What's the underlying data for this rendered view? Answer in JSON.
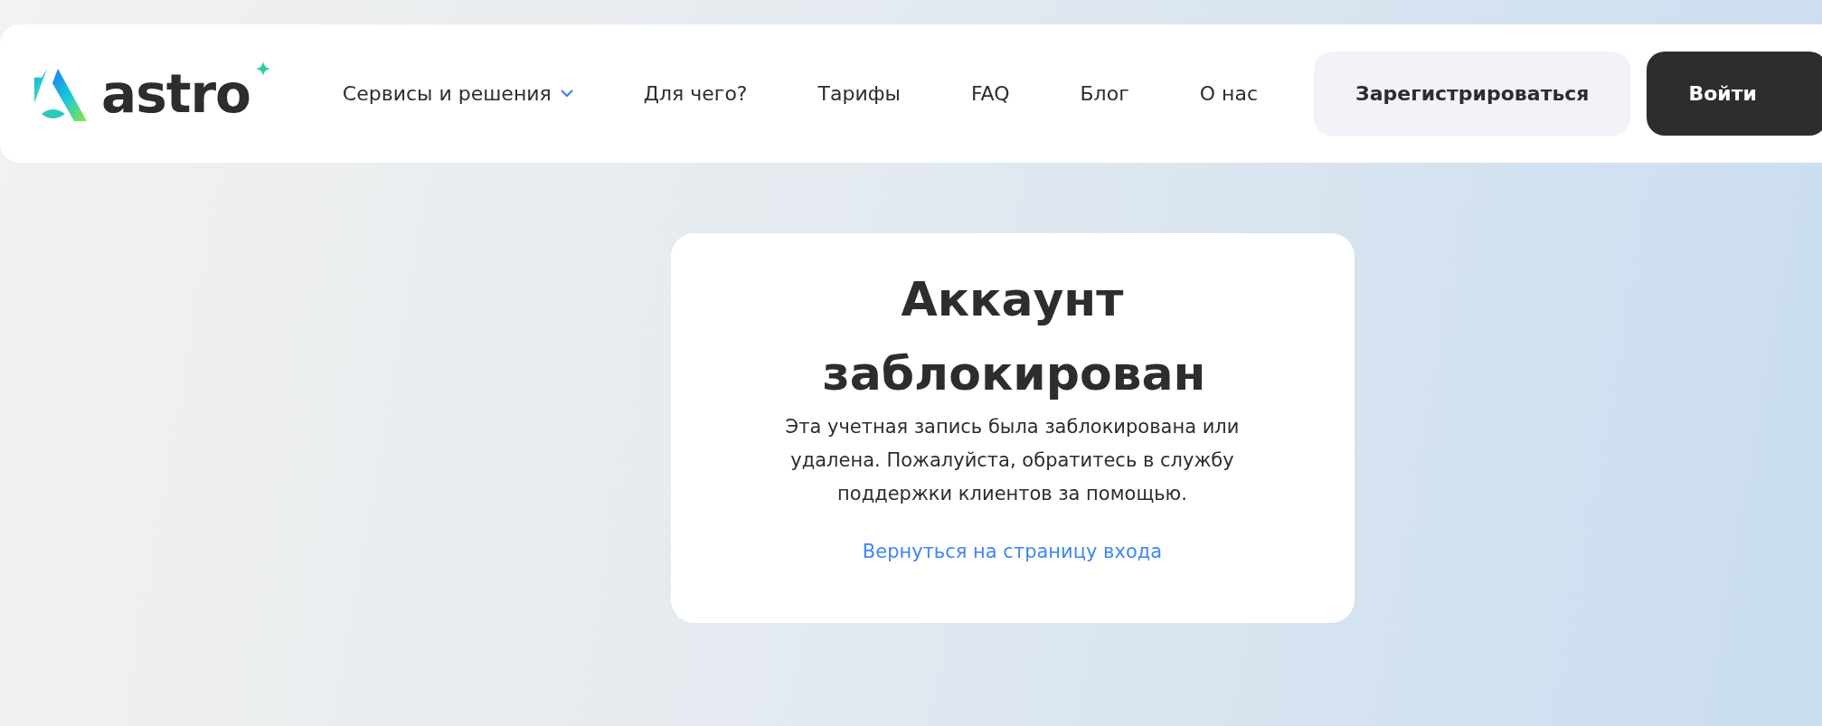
{
  "header": {
    "logo_text": "astro",
    "nav": [
      {
        "label": "Сервисы и решения",
        "kind": "dropdown"
      },
      {
        "label": "Для чего?",
        "kind": "link"
      },
      {
        "label": "Тарифы",
        "kind": "link"
      },
      {
        "label": "FAQ",
        "kind": "link"
      },
      {
        "label": "Блог",
        "kind": "link"
      },
      {
        "label": "О нас",
        "kind": "link"
      }
    ],
    "buttons": [
      {
        "label": "Зарегистрироваться",
        "kind": "secondary"
      },
      {
        "label": "Войти",
        "kind": "primary"
      }
    ]
  },
  "card": {
    "title": "Аккаунт заблокирован",
    "message": "Эта учетная запись была заблокирована или удалена. Пожалуйста, обратитесь в службу поддержки клиентов за помощью.",
    "link": "Вернуться на страницу входа"
  }
}
